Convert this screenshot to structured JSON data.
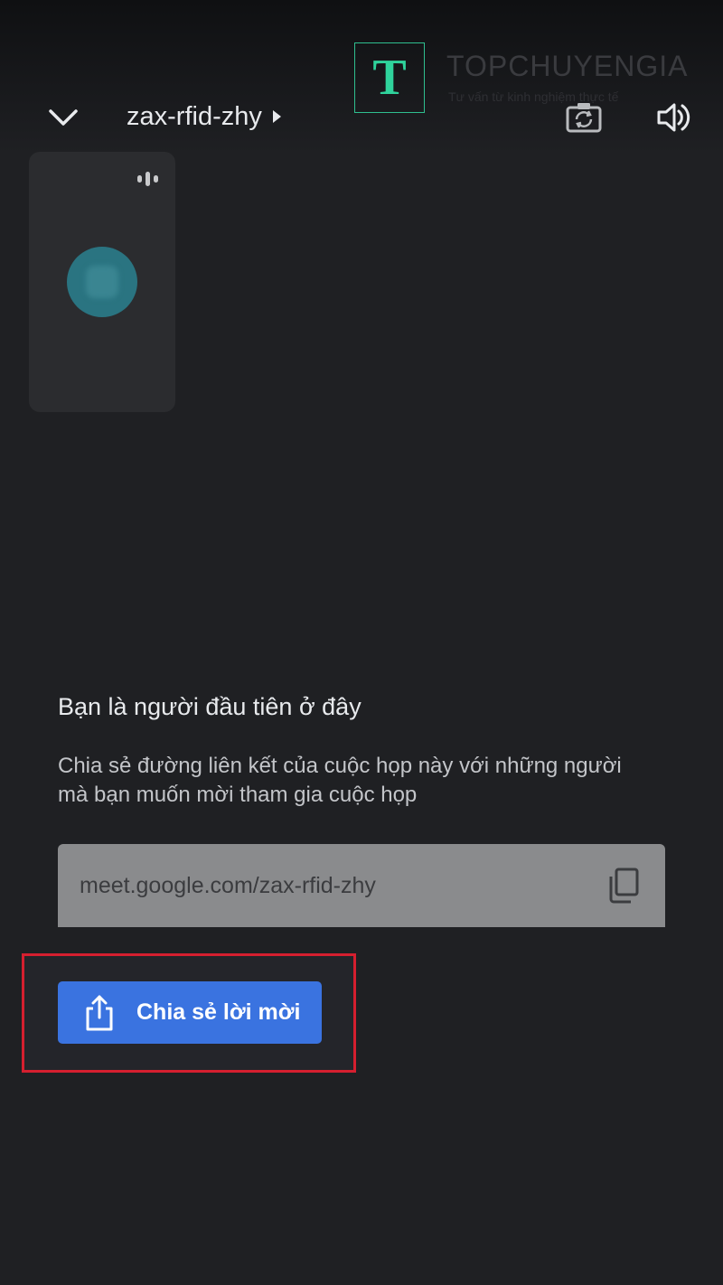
{
  "header": {
    "meeting_code": "zax-rfid-zhy",
    "collapse_icon": "chevron-down-icon",
    "switch_camera_icon": "camera-switch-icon",
    "audio_icon": "speaker-icon"
  },
  "watermark": {
    "logo_letter": "T",
    "brand": "TOPCHUYENGIA",
    "tagline": "Tư vấn từ kinh nghiệm thực tế"
  },
  "self_view": {
    "speaking_icon": "audio-level-icon",
    "avatar_color": "#2a7481"
  },
  "first_here": {
    "title": "Bạn là người đầu tiên ở đây",
    "description": "Chia sẻ đường liên kết của cuộc họp này với những người mà bạn muốn mời tham gia cuộc họp"
  },
  "meeting_link": {
    "url": "meet.google.com/zax-rfid-zhy",
    "copy_icon": "copy-icon"
  },
  "share": {
    "label": "Chia sẻ lời mời",
    "icon": "share-icon",
    "button_color": "#3a73e0",
    "highlight_color": "#d51f2f"
  }
}
